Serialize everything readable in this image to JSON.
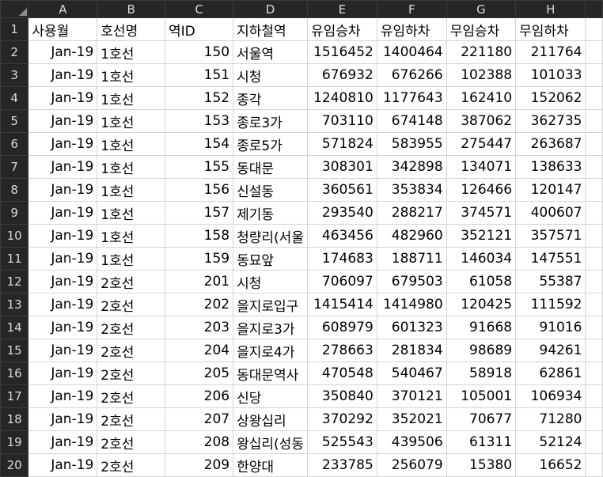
{
  "columns": [
    "A",
    "B",
    "C",
    "D",
    "E",
    "F",
    "G",
    "H"
  ],
  "header_row": {
    "row_number": "1",
    "cells": [
      "사용월",
      "호선명",
      "역ID",
      "지하철역",
      "유임승차",
      "유임하차",
      "무임승차",
      "무임하차"
    ]
  },
  "rows": [
    {
      "n": "2",
      "month": "Jan-19",
      "line": "1호선",
      "id": "150",
      "station": "서울역",
      "a": "1516452",
      "b": "1400464",
      "c": "221180",
      "d": "211764"
    },
    {
      "n": "3",
      "month": "Jan-19",
      "line": "1호선",
      "id": "151",
      "station": "시청",
      "a": "676932",
      "b": "676266",
      "c": "102388",
      "d": "101033"
    },
    {
      "n": "4",
      "month": "Jan-19",
      "line": "1호선",
      "id": "152",
      "station": "종각",
      "a": "1240810",
      "b": "1177643",
      "c": "162410",
      "d": "152062"
    },
    {
      "n": "5",
      "month": "Jan-19",
      "line": "1호선",
      "id": "153",
      "station": "종로3가",
      "a": "703110",
      "b": "674148",
      "c": "387062",
      "d": "362735"
    },
    {
      "n": "6",
      "month": "Jan-19",
      "line": "1호선",
      "id": "154",
      "station": "종로5가",
      "a": "571824",
      "b": "583955",
      "c": "275447",
      "d": "263687"
    },
    {
      "n": "7",
      "month": "Jan-19",
      "line": "1호선",
      "id": "155",
      "station": "동대문",
      "a": "308301",
      "b": "342898",
      "c": "134071",
      "d": "138633"
    },
    {
      "n": "8",
      "month": "Jan-19",
      "line": "1호선",
      "id": "156",
      "station": "신설동",
      "a": "360561",
      "b": "353834",
      "c": "126466",
      "d": "120147"
    },
    {
      "n": "9",
      "month": "Jan-19",
      "line": "1호선",
      "id": "157",
      "station": "제기동",
      "a": "293540",
      "b": "288217",
      "c": "374571",
      "d": "400607"
    },
    {
      "n": "10",
      "month": "Jan-19",
      "line": "1호선",
      "id": "158",
      "station": "청량리(서울",
      "a": "463456",
      "b": "482960",
      "c": "352121",
      "d": "357571"
    },
    {
      "n": "11",
      "month": "Jan-19",
      "line": "1호선",
      "id": "159",
      "station": "동묘앞",
      "a": "174683",
      "b": "188711",
      "c": "146034",
      "d": "147551"
    },
    {
      "n": "12",
      "month": "Jan-19",
      "line": "2호선",
      "id": "201",
      "station": "시청",
      "a": "706097",
      "b": "679503",
      "c": "61058",
      "d": "55387"
    },
    {
      "n": "13",
      "month": "Jan-19",
      "line": "2호선",
      "id": "202",
      "station": "을지로입구",
      "a": "1415414",
      "b": "1414980",
      "c": "120425",
      "d": "111592"
    },
    {
      "n": "14",
      "month": "Jan-19",
      "line": "2호선",
      "id": "203",
      "station": "을지로3가",
      "a": "608979",
      "b": "601323",
      "c": "91668",
      "d": "91016"
    },
    {
      "n": "15",
      "month": "Jan-19",
      "line": "2호선",
      "id": "204",
      "station": "을지로4가",
      "a": "278663",
      "b": "281834",
      "c": "98689",
      "d": "94261"
    },
    {
      "n": "16",
      "month": "Jan-19",
      "line": "2호선",
      "id": "205",
      "station": "동대문역사",
      "a": "470548",
      "b": "540467",
      "c": "58918",
      "d": "62861"
    },
    {
      "n": "17",
      "month": "Jan-19",
      "line": "2호선",
      "id": "206",
      "station": "신당",
      "a": "350840",
      "b": "370121",
      "c": "105001",
      "d": "106934"
    },
    {
      "n": "18",
      "month": "Jan-19",
      "line": "2호선",
      "id": "207",
      "station": "상왕십리",
      "a": "370292",
      "b": "352021",
      "c": "70677",
      "d": "71280"
    },
    {
      "n": "19",
      "month": "Jan-19",
      "line": "2호선",
      "id": "208",
      "station": "왕십리(성동",
      "a": "525543",
      "b": "439506",
      "c": "61311",
      "d": "52124"
    },
    {
      "n": "20",
      "month": "Jan-19",
      "line": "2호선",
      "id": "209",
      "station": "한양대",
      "a": "233785",
      "b": "256079",
      "c": "15380",
      "d": "16652"
    }
  ]
}
